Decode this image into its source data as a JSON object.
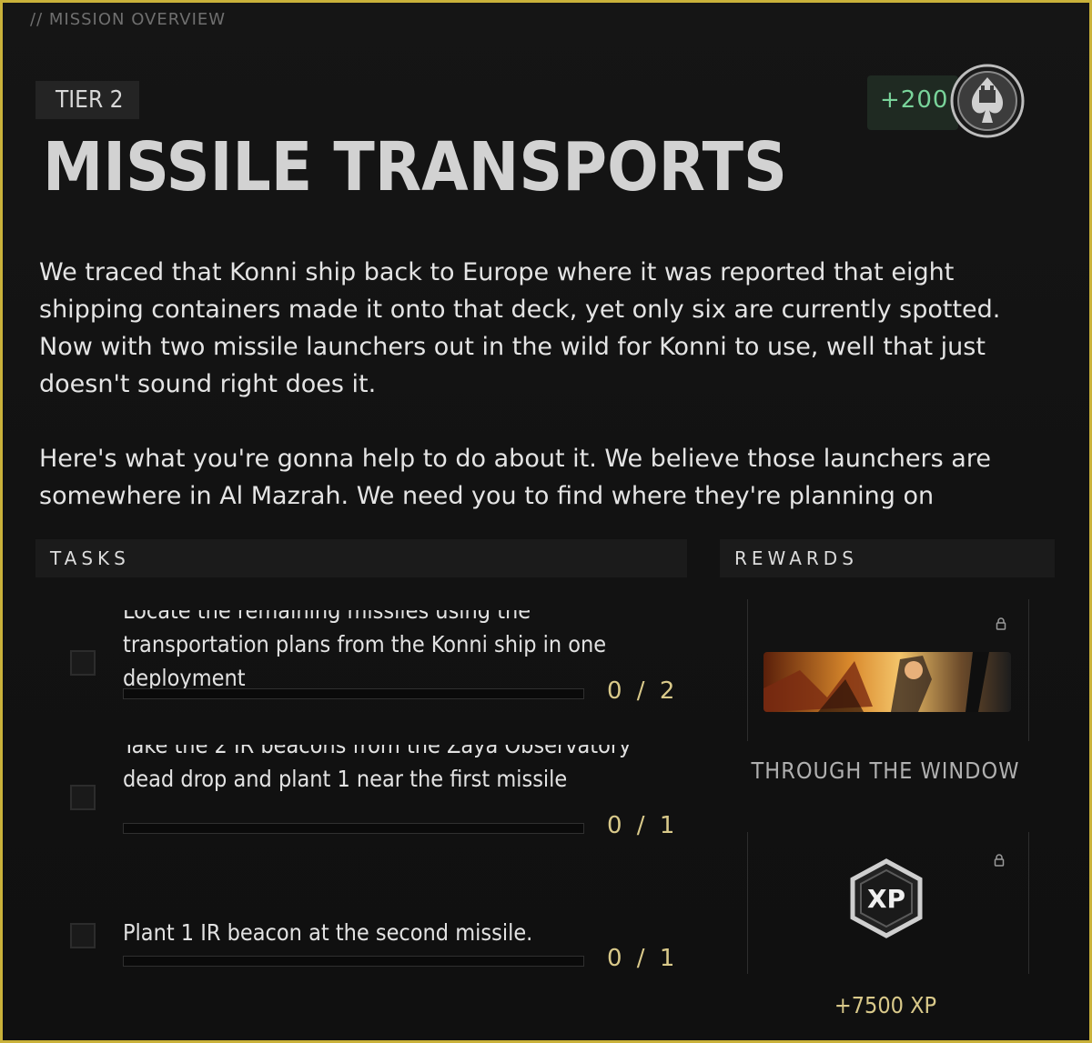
{
  "header": {
    "overview_label": "// MISSION OVERVIEW",
    "tier": "TIER 2",
    "reward_points": "+200",
    "title": "MISSILE TRANSPORTS"
  },
  "description": {
    "paragraphs": [
      "We traced that Konni ship back to Europe where it was reported that eight shipping containers made it onto that deck, yet only six are currently spotted. Now with two missile launchers out in the wild for Konni to use, well that just doesn't sound right does it.",
      "Here's what you're gonna help to do about it. We believe those launchers are somewhere in Al Mazrah. We need you to find where they're planning on"
    ]
  },
  "tasks": {
    "header": "TASKS",
    "items": [
      {
        "text": "Locate the remaining missiles using the transportation plans from the Konni ship in one deployment",
        "count": "0 / 2",
        "progress": 0
      },
      {
        "text": "Take the 2 IR beacons from the Zaya Observatory dead drop and plant 1 near the first missile",
        "count": "0 / 1",
        "progress": 0
      },
      {
        "text": "Plant 1 IR beacon at the second missile.",
        "count": "0 / 1",
        "progress": 0
      }
    ]
  },
  "rewards": {
    "header": "REWARDS",
    "calling_card_name": "THROUGH THE WINDOW",
    "xp_icon_label": "XP",
    "xp_amount": "+7500 XP"
  },
  "colors": {
    "accent_frame": "#c9b13a",
    "points_green": "#79d39a",
    "count_gold": "#d9c98a"
  },
  "icons": [
    "lock-icon",
    "coin-icon",
    "xp-icon"
  ]
}
